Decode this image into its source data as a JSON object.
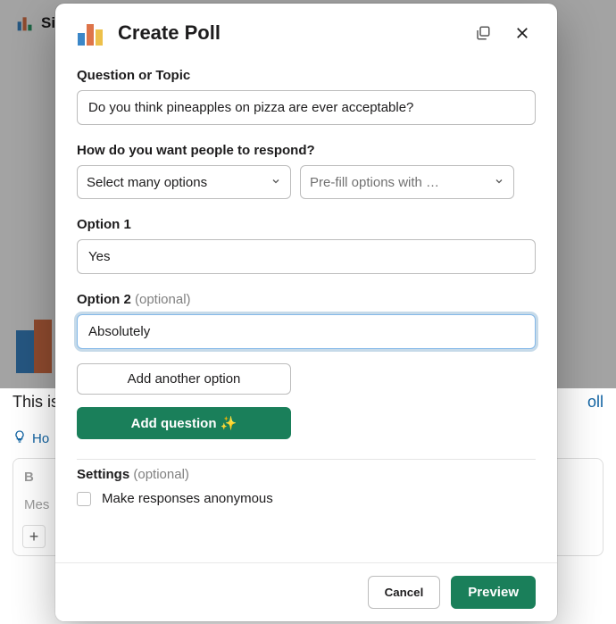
{
  "background": {
    "workspace_initial": "Si",
    "body_text_left": "This is",
    "body_text_right": "oll",
    "hint_text": "Ho",
    "composer_placeholder": "Mes",
    "toolbar_bold": "B"
  },
  "modal": {
    "title": "Create Poll",
    "question": {
      "label": "Question or Topic",
      "value": "Do you think pineapples on pizza are ever acceptable?"
    },
    "respond": {
      "label": "How do you want people to respond?",
      "select_mode": "Select many options",
      "prefill": "Pre-fill options with …"
    },
    "options": [
      {
        "label": "Option 1",
        "optional": "",
        "value": "Yes",
        "focused": false
      },
      {
        "label": "Option 2",
        "optional": "(optional)",
        "value": "Absolutely",
        "focused": true
      }
    ],
    "add_option_label": "Add another option",
    "add_question_label": "Add question ✨",
    "settings": {
      "label": "Settings",
      "optional": "(optional)",
      "anonymous_label": "Make responses anonymous"
    },
    "footer": {
      "cancel": "Cancel",
      "preview": "Preview"
    }
  }
}
